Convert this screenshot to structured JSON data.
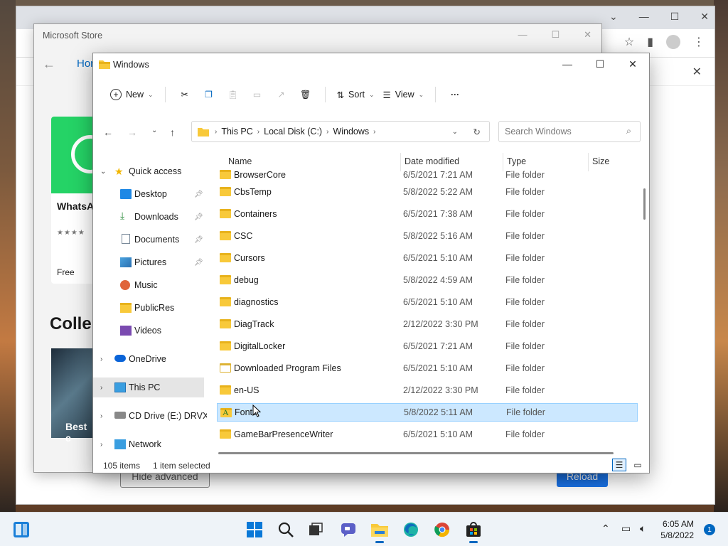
{
  "store": {
    "title": "Microsoft Store",
    "home_tab": "Hor",
    "app_name": "WhatsA Desktop",
    "stars": "★★★★",
    "price": "Free",
    "section_title": "Colle",
    "tile_text": "Best c"
  },
  "chrome": {
    "hide_advanced": "Hide advanced",
    "reload": "Reload"
  },
  "explorer": {
    "title": "Windows",
    "toolbar": {
      "new": "New",
      "sort": "Sort",
      "view": "View"
    },
    "address": [
      "This PC",
      "Local Disk (C:)",
      "Windows"
    ],
    "search_placeholder": "Search Windows",
    "columns": {
      "name": "Name",
      "date": "Date modified",
      "type": "Type",
      "size": "Size"
    },
    "sidebar": {
      "quick_access": "Quick access",
      "items": [
        "Desktop",
        "Downloads",
        "Documents",
        "Pictures",
        "Music",
        "PublicRes",
        "Videos"
      ],
      "onedrive": "OneDrive",
      "this_pc": "This PC",
      "cd_drive": "CD Drive (E:) DRVXP",
      "network": "Network"
    },
    "rows": [
      {
        "name": "BrowserCore",
        "date": "6/5/2021 7:21 AM",
        "type": "File folder"
      },
      {
        "name": "CbsTemp",
        "date": "5/8/2022 5:22 AM",
        "type": "File folder"
      },
      {
        "name": "Containers",
        "date": "6/5/2021 7:38 AM",
        "type": "File folder"
      },
      {
        "name": "CSC",
        "date": "5/8/2022 5:16 AM",
        "type": "File folder"
      },
      {
        "name": "Cursors",
        "date": "6/5/2021 5:10 AM",
        "type": "File folder"
      },
      {
        "name": "debug",
        "date": "5/8/2022 4:59 AM",
        "type": "File folder"
      },
      {
        "name": "diagnostics",
        "date": "6/5/2021 5:10 AM",
        "type": "File folder"
      },
      {
        "name": "DiagTrack",
        "date": "2/12/2022 3:30 PM",
        "type": "File folder"
      },
      {
        "name": "DigitalLocker",
        "date": "6/5/2021 7:21 AM",
        "type": "File folder"
      },
      {
        "name": "Downloaded Program Files",
        "date": "6/5/2021 5:10 AM",
        "type": "File folder"
      },
      {
        "name": "en-US",
        "date": "2/12/2022 3:30 PM",
        "type": "File folder"
      },
      {
        "name": "Fonts",
        "date": "5/8/2022 5:11 AM",
        "type": "File folder"
      },
      {
        "name": "GameBarPresenceWriter",
        "date": "6/5/2021 5:10 AM",
        "type": "File folder"
      }
    ],
    "status": {
      "count": "105 items",
      "selected": "1 item selected"
    }
  },
  "taskbar": {
    "time": "6:05 AM",
    "date": "5/8/2022",
    "notifications": "1"
  }
}
